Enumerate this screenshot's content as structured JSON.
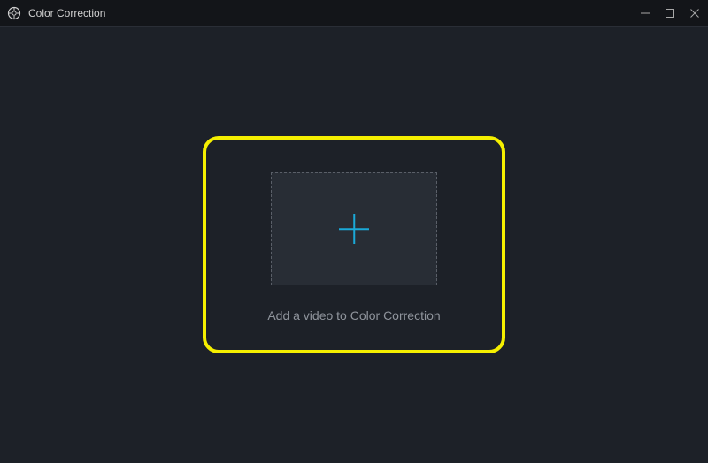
{
  "titlebar": {
    "title": "Color Correction"
  },
  "main": {
    "drop_label": "Add a video to Color Correction"
  }
}
